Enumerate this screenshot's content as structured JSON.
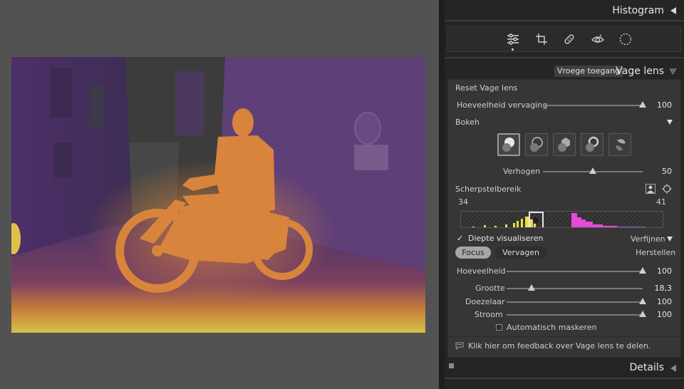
{
  "panel": {
    "histogram_title": "Histogram",
    "details_title": "Details"
  },
  "toolbar": {
    "tools": [
      "edit-sliders-icon",
      "crop-icon",
      "healing-icon",
      "red-eye-icon",
      "masking-icon"
    ]
  },
  "lens_blur": {
    "early_access_badge": "Vroege toegang",
    "title": "Vage lens",
    "reset_label": "Reset Vage lens",
    "blur_amount_label": "Hoeveelheid vervaging",
    "blur_amount_value": "100",
    "blur_amount": 100,
    "bokeh_label": "Bokeh",
    "bokeh_shapes": [
      "bokeh-circle",
      "bokeh-bubble",
      "bokeh-5-blade",
      "bokeh-ring",
      "bokeh-cat-eye"
    ],
    "bokeh_selected": 0,
    "boost_label": "Verhogen",
    "boost_value": "50",
    "boost": 50,
    "focal_range_label": "Scherpstelbereik",
    "focal_min": "34",
    "focal_max": "41",
    "visualize_depth_label": "Diepte visualiseren",
    "visualize_depth_checked": true,
    "refine_label": "Verfijnen",
    "focus_tab": "Focus",
    "blur_tab": "Vervagen",
    "reset_short": "Herstellen",
    "amount_label": "Hoeveelheid",
    "amount_value": "100",
    "amount": 100,
    "size_label": "Grootte",
    "size_value": "18,3",
    "size": 18.3,
    "feather_label": "Doezelaar",
    "feather_value": "100",
    "feather": 100,
    "flow_label": "Stroom",
    "flow_value": "100",
    "flow": 100,
    "auto_mask_label": "Automatisch maskeren",
    "auto_mask_checked": false,
    "feedback_text": "Klik hier om feedback over Vage lens te delen."
  },
  "colors": {
    "depth_near": "#e8c54a",
    "depth_mid": "#e07a2a",
    "depth_far": "#5b3f73",
    "subject_focus": "#d9843c",
    "histogram_yellow": "#e8e04a",
    "histogram_magenta": "#e64ad8"
  }
}
